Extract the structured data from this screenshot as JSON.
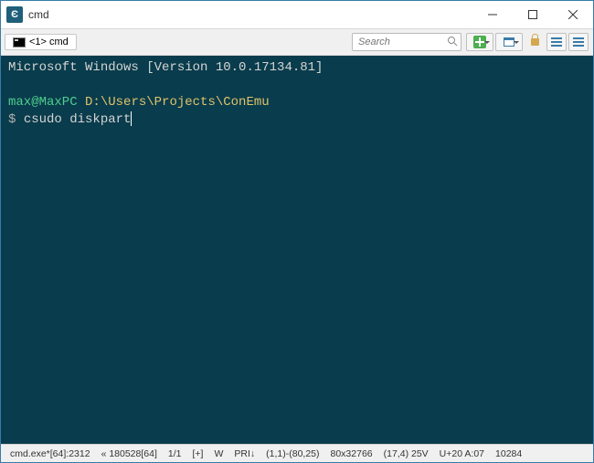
{
  "title": "cmd",
  "tab": {
    "label": "<1> cmd"
  },
  "search": {
    "placeholder": "Search"
  },
  "terminal": {
    "version_line": "Microsoft Windows [Version 10.0.17134.81]",
    "user": "max@MaxPC",
    "path": "D:\\Users\\Projects\\ConEmu",
    "prompt": "$ ",
    "command": "csudo diskpart"
  },
  "status": {
    "proc": "cmd.exe*[64]:2312",
    "build": "« 180528[64]",
    "page": "1/1",
    "caps": "[+]",
    "wrap": "W",
    "pri": "PRI↓",
    "sel": "(1,1)-(80,25)",
    "size": "80x32766",
    "cursor": "(17,4) 25V",
    "enc": "U+20 A:07",
    "pid": "10284"
  },
  "colors": {
    "accent": "#3a7ba8",
    "term_bg": "#093c4c"
  }
}
